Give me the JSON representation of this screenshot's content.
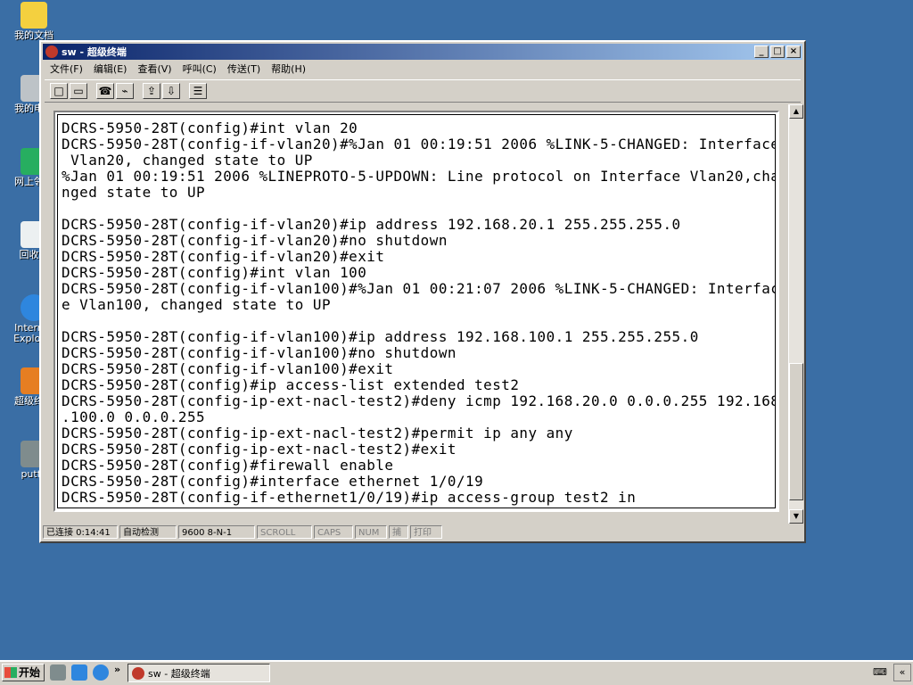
{
  "desktop": {
    "icons": [
      {
        "label": "我的文档"
      },
      {
        "label": "我的电脑"
      },
      {
        "label": "网上邻居"
      },
      {
        "label": "回收站"
      },
      {
        "label": "Internet Explorer"
      },
      {
        "label": "超级终端"
      },
      {
        "label": "putty"
      }
    ]
  },
  "window": {
    "title": "sw - 超级终端",
    "menu": [
      "文件(F)",
      "编辑(E)",
      "查看(V)",
      "呼叫(C)",
      "传送(T)",
      "帮助(H)"
    ],
    "terminal_lines": [
      "DCRS-5950-28T(config)#int vlan 20",
      "DCRS-5950-28T(config-if-vlan20)#%Jan 01 00:19:51 2006 %LINK-5-CHANGED: Interface",
      " Vlan20, changed state to UP",
      "%Jan 01 00:19:51 2006 %LINEPROTO-5-UPDOWN: Line protocol on Interface Vlan20,cha",
      "nged state to UP",
      "",
      "DCRS-5950-28T(config-if-vlan20)#ip address 192.168.20.1 255.255.255.0",
      "DCRS-5950-28T(config-if-vlan20)#no shutdown",
      "DCRS-5950-28T(config-if-vlan20)#exit",
      "DCRS-5950-28T(config)#int vlan 100",
      "DCRS-5950-28T(config-if-vlan100)#%Jan 01 00:21:07 2006 %LINK-5-CHANGED: Interfac",
      "e Vlan100, changed state to UP",
      "",
      "DCRS-5950-28T(config-if-vlan100)#ip address 192.168.100.1 255.255.255.0",
      "DCRS-5950-28T(config-if-vlan100)#no shutdown",
      "DCRS-5950-28T(config-if-vlan100)#exit",
      "DCRS-5950-28T(config)#ip access-list extended test2",
      "DCRS-5950-28T(config-ip-ext-nacl-test2)#deny icmp 192.168.20.0 0.0.0.255 192.168",
      ".100.0 0.0.0.255",
      "DCRS-5950-28T(config-ip-ext-nacl-test2)#permit ip any any",
      "DCRS-5950-28T(config-ip-ext-nacl-test2)#exit",
      "DCRS-5950-28T(config)#firewall enable",
      "DCRS-5950-28T(config)#interface ethernet 1/0/19",
      "DCRS-5950-28T(config-if-ethernet1/0/19)#ip access-group test2 in"
    ],
    "status": {
      "connected": "已连接 0:14:41",
      "detect": "自动检测",
      "port": "9600 8-N-1",
      "scroll": "SCROLL",
      "caps": "CAPS",
      "num": "NUM",
      "capture": "捕",
      "print": "打印"
    }
  },
  "taskbar": {
    "start_label": "开始",
    "task_label": "sw - 超级终端",
    "chevron": "»"
  }
}
